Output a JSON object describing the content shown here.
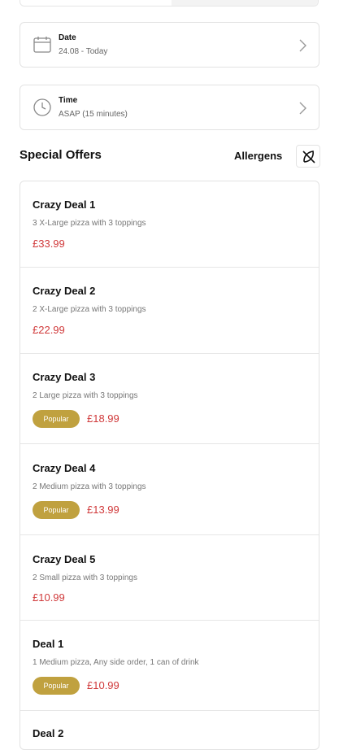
{
  "order": {
    "date_label": "Date",
    "date_value": "24.08 - Today",
    "time_label": "Time",
    "time_value": "ASAP (15 minutes)"
  },
  "section": {
    "title": "Special Offers",
    "allergens_label": "Allergens"
  },
  "offers": [
    {
      "name": "Crazy Deal 1",
      "description": "3 X-Large pizza with 3 toppings",
      "price": "£33.99"
    },
    {
      "name": "Crazy Deal 2",
      "description": "2 X-Large pizza with 3 toppings",
      "price": "£22.99"
    },
    {
      "name": "Crazy Deal 3",
      "description": "2 Large pizza with 3 toppings",
      "price": "£18.99",
      "badge": "Popular"
    },
    {
      "name": "Crazy Deal 4",
      "description": "2 Medium pizza with 3 toppings",
      "price": "£13.99",
      "badge": "Popular"
    },
    {
      "name": "Crazy Deal 5",
      "description": "2 Small pizza with 3 toppings",
      "price": "£10.99"
    },
    {
      "name": "Deal 1",
      "description": "1 Medium pizza, Any side order, 1 can of drink",
      "price": "£10.99",
      "badge": "Popular"
    },
    {
      "name": "Deal 2"
    }
  ],
  "colors": {
    "price": "#d0393a",
    "badge": "#c0a13f"
  },
  "icons": {
    "date": "calendar-icon",
    "time": "clock-icon",
    "allergens": "allergens-icon",
    "chevron": "chevron-right-icon"
  }
}
